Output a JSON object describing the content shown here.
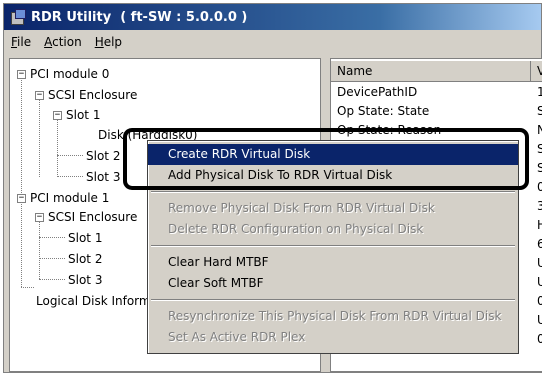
{
  "window": {
    "title": "RDR Utility  ( ft-SW : 5.0.0.0 )"
  },
  "menu": [
    {
      "pre": "",
      "mn": "F",
      "rest": "ile"
    },
    {
      "pre": "",
      "mn": "A",
      "rest": "ction"
    },
    {
      "pre": "",
      "mn": "H",
      "rest": "elp"
    }
  ],
  "tree": {
    "pci0": "PCI module 0",
    "scsi0": "SCSI Enclosure",
    "slot1": "Slot 1",
    "disk": "Disk (Harddisk0)",
    "slot2": "Slot 2",
    "slot3": "Slot 3",
    "pci1": "PCI module 1",
    "scsi1": "SCSI Enclosure",
    "slot1b": "Slot 1",
    "slot2b": "Slot 2",
    "slot3b": "Slot 3",
    "logical": "Logical Disk Information"
  },
  "list": {
    "col_name": "Name",
    "col_value": "Value",
    "rows": [
      "DevicePathID",
      "Op State: State",
      "Op State: Reason"
    ],
    "values": [
      "1",
      "S",
      "N",
      "S",
      "S",
      "0",
      "3",
      "H",
      "6",
      "U",
      "U",
      "0",
      "U",
      "0"
    ]
  },
  "context_menu": {
    "create": "Create RDR Virtual Disk",
    "add": "Add Physical Disk To RDR Virtual Disk",
    "remove": "Remove Physical Disk From RDR Virtual Disk",
    "delete": "Delete RDR Configuration on Physical Disk",
    "clear_hard": "Clear Hard MTBF",
    "clear_soft": "Clear Soft MTBF",
    "resync": "Resynchronize This Physical Disk From RDR Virtual Disk",
    "set_active": "Set As Active RDR Plex"
  }
}
